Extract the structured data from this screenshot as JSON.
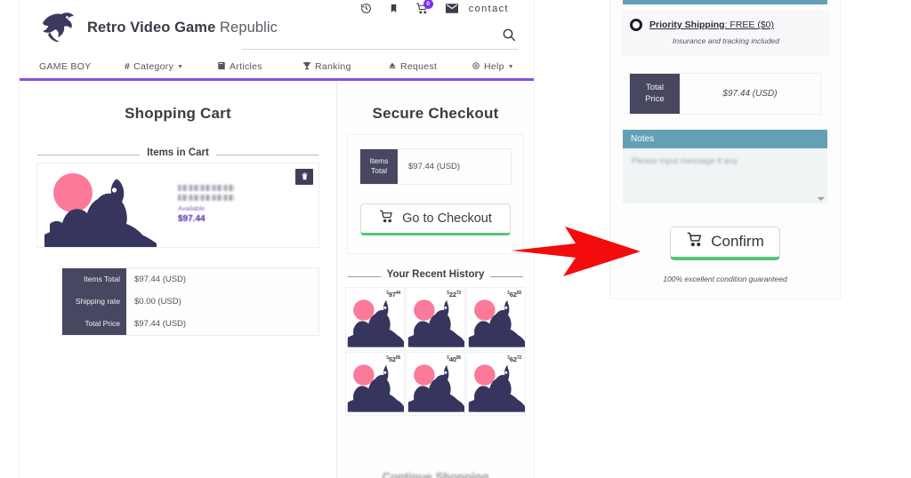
{
  "site": {
    "brand_bold": "Retro Video Game",
    "brand_light": "Republic",
    "logo_icon": "dragon-logo-icon"
  },
  "utility_bar": {
    "history_icon": "history-clock-icon",
    "bookmark_icon": "bookmark-icon",
    "cart_icon": "shopping-cart-icon",
    "cart_badge": "0",
    "mail_icon": "envelope-icon",
    "contact_label": "contact",
    "search_icon": "search-icon"
  },
  "nav": {
    "items": [
      {
        "label": "GAME BOY",
        "icon": "",
        "caret": ""
      },
      {
        "label": "Category",
        "icon": "#",
        "caret": "▾"
      },
      {
        "label": "Articles",
        "icon": "book-icon",
        "caret": ""
      },
      {
        "label": "Ranking",
        "icon": "trophy-icon",
        "caret": ""
      },
      {
        "label": "Request",
        "icon": "upload-icon",
        "caret": ""
      },
      {
        "label": "Help",
        "icon": "gear-icon",
        "caret": "▾"
      }
    ],
    "accent_color": "#8a4fe0"
  },
  "cart": {
    "title": "Shopping Cart",
    "items_section_label": "Items in Cart",
    "item": {
      "title_blurred": true,
      "availability": "Available",
      "price": "$97.44",
      "delete_icon": "trash-icon"
    },
    "totals": [
      {
        "label": "Items Total",
        "value": "$97.44 (USD)"
      },
      {
        "label": "Shipping rate",
        "value": "$0.00 (USD)"
      },
      {
        "label": "Total Price",
        "value": "$97.44 (USD)"
      }
    ]
  },
  "checkout": {
    "title": "Secure Checkout",
    "items_total_label": "Items\nTotal",
    "items_total_label_line1": "Items",
    "items_total_label_line2": "Total",
    "items_total_value": "$97.44 (USD)",
    "checkout_button": "Go to Checkout",
    "checkout_button_icon": "shopping-cart-icon",
    "history_label": "Your Recent History",
    "history": [
      {
        "currency": "$",
        "dollars": "97",
        "cents": "44"
      },
      {
        "currency": "$",
        "dollars": "22",
        "cents": "72"
      },
      {
        "currency": "$",
        "dollars": "62",
        "cents": "50"
      },
      {
        "currency": "$",
        "dollars": "52",
        "cents": "05"
      },
      {
        "currency": "$",
        "dollars": "40",
        "cents": "95"
      },
      {
        "currency": "$",
        "dollars": "62",
        "cents": "72"
      }
    ],
    "continue_shopping": "Continue Shopping"
  },
  "confirm_panel": {
    "shipping_option": {
      "radio_icon": "radio-selected-icon",
      "name": "Priority Shipping",
      "price_text": ": FREE ($0)",
      "subtitle": "Insurance and tracking included"
    },
    "total_price_label_line1": "Total",
    "total_price_label_line2": "Price",
    "total_price_value": "$97.44 (USD)",
    "notes_header": "Notes",
    "notes_placeholder": "Please input message if any",
    "notes_resize_icon": "resize-grip-icon",
    "confirm_button": "Confirm",
    "confirm_button_icon": "shopping-cart-icon",
    "guarantee": "100% excellent condition guaranteed"
  },
  "annotation": {
    "arrow_icon": "right-arrow-annotation",
    "arrow_color": "#f40b0b"
  }
}
